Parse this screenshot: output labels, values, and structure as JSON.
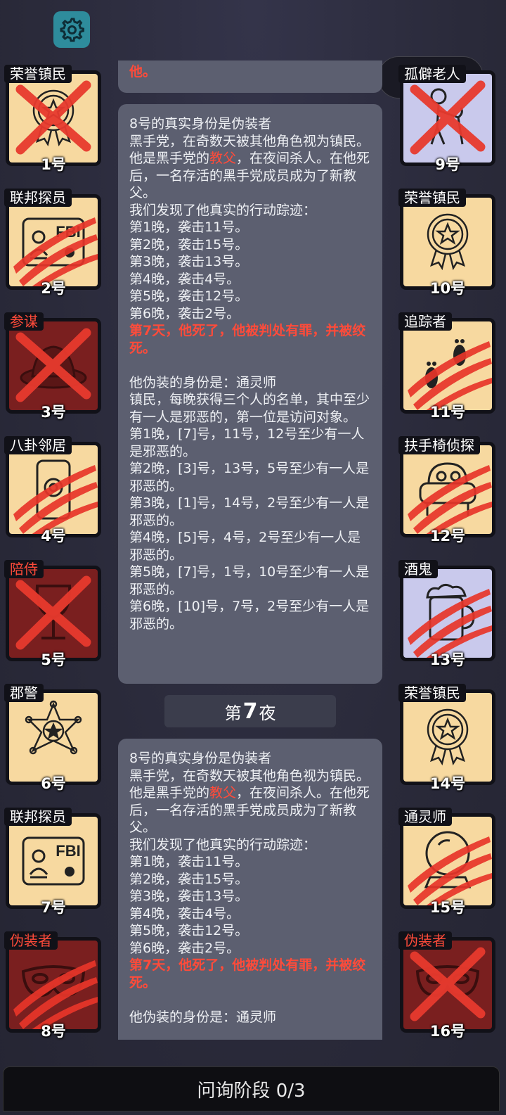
{
  "header": {
    "settings_icon": "gear-icon",
    "menu_icon": "more-dots-icon",
    "close_icon": "target-close-icon"
  },
  "colors": {
    "accent_red": "#ff4b3a",
    "card_light": "#f7d9a0",
    "card_dark": "#7a1f1f",
    "card_lavender": "#c9c9ec",
    "panel": "#5c5f70"
  },
  "players_left": [
    {
      "num": "1号",
      "role": "荣誉镇民",
      "icon": "medal-icon",
      "bg": "light",
      "mark": "x",
      "red": false
    },
    {
      "num": "2号",
      "role": "联邦探员",
      "icon": "fbi-badge-icon",
      "bg": "light",
      "mark": "claw",
      "red": false
    },
    {
      "num": "3号",
      "role": "参谋",
      "icon": "hat-icon",
      "bg": "dark",
      "mark": "x",
      "red": true
    },
    {
      "num": "4号",
      "role": "八卦邻居",
      "icon": "phone-icon",
      "bg": "light",
      "mark": "claw",
      "red": false
    },
    {
      "num": "5号",
      "role": "陪侍",
      "icon": "wine-glass-icon",
      "bg": "dark",
      "mark": "x",
      "red": true
    },
    {
      "num": "6号",
      "role": "郡警",
      "icon": "sheriff-star-icon",
      "bg": "light",
      "mark": "none",
      "red": false
    },
    {
      "num": "7号",
      "role": "联邦探员",
      "icon": "fbi-badge-icon",
      "bg": "light",
      "mark": "none",
      "red": false
    },
    {
      "num": "8号",
      "role": "伪装者",
      "icon": "mask-icon",
      "bg": "dark",
      "mark": "claw",
      "red": true
    }
  ],
  "players_right": [
    {
      "num": "9号",
      "role": "孤僻老人",
      "icon": "cane-icon",
      "bg": "lavender",
      "mark": "x",
      "red": false
    },
    {
      "num": "10号",
      "role": "荣誉镇民",
      "icon": "medal-icon",
      "bg": "light",
      "mark": "none",
      "red": false
    },
    {
      "num": "11号",
      "role": "追踪者",
      "icon": "footprints-icon",
      "bg": "light",
      "mark": "claw",
      "red": false
    },
    {
      "num": "12号",
      "role": "扶手椅侦探",
      "icon": "armchair-icon",
      "bg": "light",
      "mark": "claw",
      "red": false
    },
    {
      "num": "13号",
      "role": "酒鬼",
      "icon": "beer-icon",
      "bg": "lavender",
      "mark": "claw",
      "red": false
    },
    {
      "num": "14号",
      "role": "荣誉镇民",
      "icon": "medal-icon",
      "bg": "light",
      "mark": "none",
      "red": false
    },
    {
      "num": "15号",
      "role": "通灵师",
      "icon": "crystal-ball-icon",
      "bg": "light",
      "mark": "claw",
      "red": false
    },
    {
      "num": "16号",
      "role": "伪装者",
      "icon": "mask-icon",
      "bg": "dark",
      "mark": "x",
      "red": true
    }
  ],
  "log": {
    "top_fragment": "他。",
    "messages": [
      {
        "line1": "8号的真实身份是伪装者",
        "line2": "黑手党，在奇数天被其他角色视为镇民。",
        "godfather_pre": "他是黑手党的",
        "godfather_word": "教父",
        "godfather_post": "，在夜间杀人。在他死后，一名存活的黑手党成员成为了新教父。",
        "trace_intro": "我们发现了他真实的行动踪迹：",
        "actions": [
          "第1晚，袭击11号。",
          "第2晚，袭击15号。",
          "第3晚，袭击13号。",
          "第4晚，袭击4号。",
          "第5晚，袭击12号。",
          "第6晚，袭击2号。"
        ],
        "death": "第7天，他死了，他被判处有罪，并被绞死。",
        "disguise_intro": "他伪装的身份是：通灵师",
        "disguise_desc": "镇民，每晚获得三个人的名单，其中至少有一人是邪恶的，第一位是访问对象。",
        "claims": [
          "第1晚，[7]号，11号，12号至少有一人是邪恶的。",
          "第2晚，[3]号，13号，5号至少有一人是邪恶的。",
          "第3晚，[1]号，14号，2号至少有一人是邪恶的。",
          "第4晚，[5]号，4号，2号至少有一人是邪恶的。",
          "第5晚，[7]号，1号，10号至少有一人是邪恶的。",
          "第6晚，[10]号，7号，2号至少有一人是邪恶的。"
        ]
      },
      {
        "line1": "8号的真实身份是伪装者",
        "line2": "黑手党，在奇数天被其他角色视为镇民。",
        "godfather_pre": "他是黑手党的",
        "godfather_word": "教父",
        "godfather_post": "，在夜间杀人。在他死后，一名存活的黑手党成员成为了新教父。",
        "trace_intro": "我们发现了他真实的行动踪迹：",
        "actions": [
          "第1晚，袭击11号。",
          "第2晚，袭击15号。",
          "第3晚，袭击13号。",
          "第4晚，袭击4号。",
          "第5晚，袭击12号。",
          "第6晚，袭击2号。"
        ],
        "death": "第7天，他死了，他被判处有罪，并被绞死。",
        "disguise_intro": "他伪装的身份是：通灵师"
      }
    ],
    "night_label_pre": "第",
    "night_label_num": "7",
    "night_label_post": "夜"
  },
  "bottom_bar": {
    "label": "问询阶段 0/3"
  }
}
